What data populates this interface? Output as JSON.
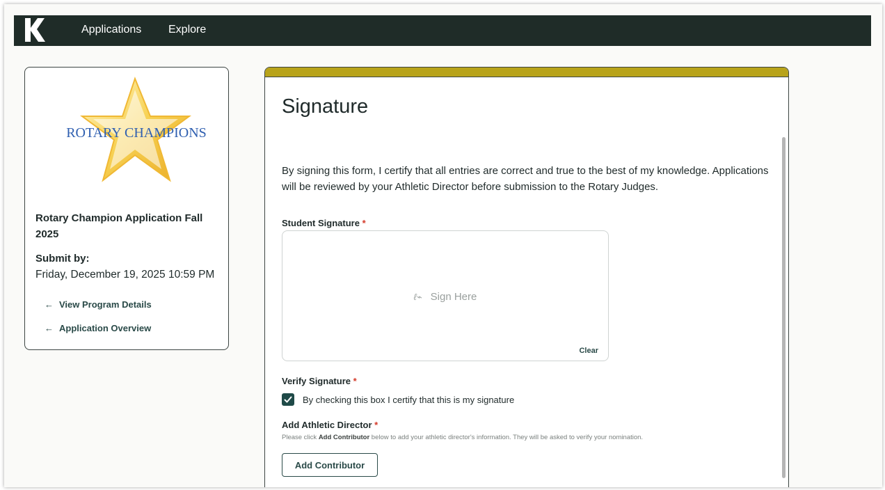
{
  "nav": {
    "logo_letter": "K",
    "items": [
      {
        "label": "Applications"
      },
      {
        "label": "Explore"
      }
    ]
  },
  "sidebar": {
    "logo_text": "ROTARY CHAMPIONS",
    "program_title": "Rotary Champion Application Fall 2025",
    "submit_label": "Submit by:",
    "submit_date": "Friday, December 19, 2025 10:59 PM",
    "links": [
      {
        "label": "View Program Details"
      },
      {
        "label": "Application Overview"
      }
    ]
  },
  "main": {
    "heading": "Signature",
    "certification_text": "By signing this form, I certify that all entries are correct and true to the best of my knowledge. Applications will be reviewed by your Athletic Director before submission to the Rotary Judges.",
    "student_signature": {
      "label": "Student Signature",
      "required_mark": "*",
      "placeholder": "Sign Here",
      "clear_label": "Clear"
    },
    "verify_signature": {
      "label": "Verify Signature",
      "required_mark": "*",
      "checkbox_text": "By checking this box I certify that this is my signature",
      "checked": true
    },
    "athletic_director": {
      "label": "Add Athletic Director",
      "required_mark": "*",
      "help_prefix": "Please click",
      "help_bold": "Add Contributor",
      "help_suffix": "below to add your athletic director's information. They will be asked to verify your nomination.",
      "button_label": "Add Contributor"
    }
  },
  "colors": {
    "navbar": "#1f2c28",
    "accent": "#b8a31a",
    "primary": "#1f4a48",
    "required": "#d43a2a"
  }
}
